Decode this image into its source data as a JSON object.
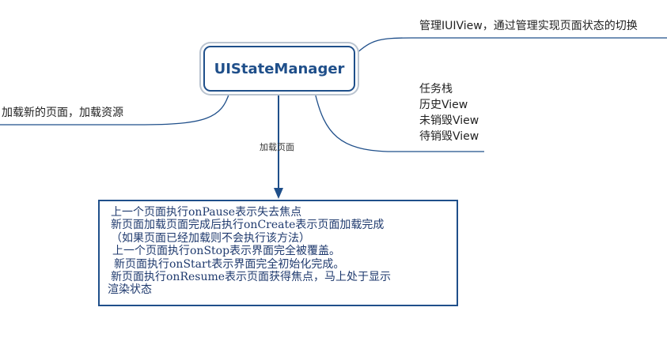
{
  "root": {
    "label": "UIStateManager"
  },
  "topics": {
    "manage": "管理IUIView，通过管理实现页面状态的切换",
    "load_new": "加载新的页面，加载资源",
    "stack_items": [
      "任务栈",
      "历史View",
      "未销毁View",
      "待销毁View"
    ]
  },
  "edge_label": "加载页面",
  "note": {
    "lines": [
      "上一个页面执行onPause表示失去焦点",
      "新页面加载页面完成后执行onCreate表示页面加载完成",
      "（如果页面已经加载则不会执行该方法）",
      "上一个页面执行onStop表示界面完全被覆盖。",
      "新页面执行onStart表示界面完全初始化完成。",
      "新页面执行onResume表示页面获得焦点，马上处于显示",
      "渲染状态"
    ]
  },
  "colors": {
    "node_border": "#1f4f8a",
    "link": "#1f4f8a",
    "note_text": "#1f3a6e"
  }
}
